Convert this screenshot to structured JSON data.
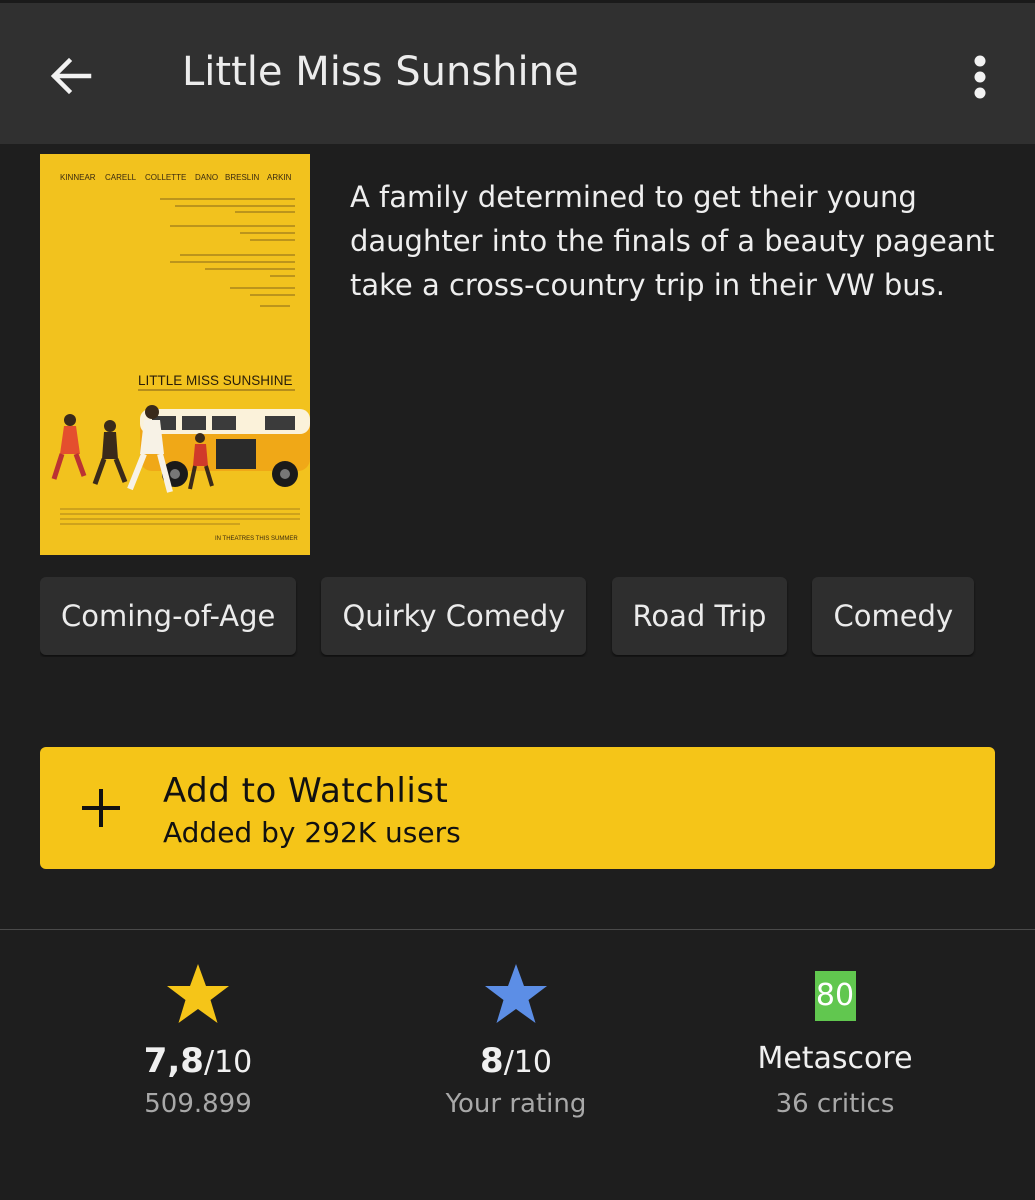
{
  "appbar": {
    "title": "Little Miss Sunshine",
    "back_icon": "arrow-left-icon",
    "more_icon": "more-vertical-icon"
  },
  "poster": {
    "cast": [
      "KINNEAR",
      "CARELL",
      "COLLETTE",
      "DANO",
      "BRESLIN",
      "ARKIN"
    ],
    "title_text": "LITTLE MISS SUNSHINE",
    "bottom_text": "IN THEATRES THIS SUMMER",
    "background_color": "#f2c21e"
  },
  "plot": "A family determined to get their young daughter into the finals of a beauty pageant take a cross-country trip in their VW bus.",
  "genres": [
    "Coming-of-Age",
    "Quirky Comedy",
    "Road Trip",
    "Comedy"
  ],
  "watchlist": {
    "label": "Add to Watchlist",
    "sub": "Added by 292K users",
    "icon": "plus-icon",
    "color": "#f5c518"
  },
  "ratings": {
    "imdb": {
      "value": "7,8",
      "suffix": "/10",
      "count": "509.899",
      "star_color": "#f5c518"
    },
    "user": {
      "value": "8",
      "suffix": "/10",
      "label": "Your rating",
      "star_color": "#5c8ee6"
    },
    "metascore": {
      "score": "80",
      "label": "Metascore",
      "critics": "36 critics",
      "color": "#61c74f"
    }
  }
}
